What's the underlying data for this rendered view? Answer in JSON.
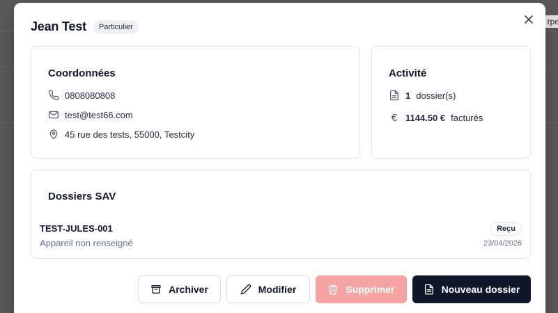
{
  "backdrop": {
    "edge_text": "rpe"
  },
  "modal": {
    "title": "Jean Test",
    "client_type": "Particulier"
  },
  "coordonnees": {
    "title": "Coordonnées",
    "phone": "0808080808",
    "email": "test@test66.com",
    "address": "45 rue des tests, 55000, Testcity"
  },
  "activite": {
    "title": "Activité",
    "dossiers_count": "1",
    "dossiers_label": "dossier(s)",
    "amount": "1144.50 €",
    "amount_label": "facturés",
    "currency_symbol": "€"
  },
  "sav": {
    "title": "Dossiers SAV",
    "items": [
      {
        "reference": "TEST-JULES-001",
        "device": "Appareil non renseigné",
        "status": "Reçu",
        "date": "23/04/2026"
      }
    ]
  },
  "actions": {
    "archive": "Archiver",
    "edit": "Modifier",
    "delete": "Supprimer",
    "new": "Nouveau dossier"
  },
  "colors": {
    "primary": "#0f172a",
    "danger_disabled": "#f5a3a3",
    "muted_text": "#64748b",
    "border": "#e2e8f0"
  }
}
